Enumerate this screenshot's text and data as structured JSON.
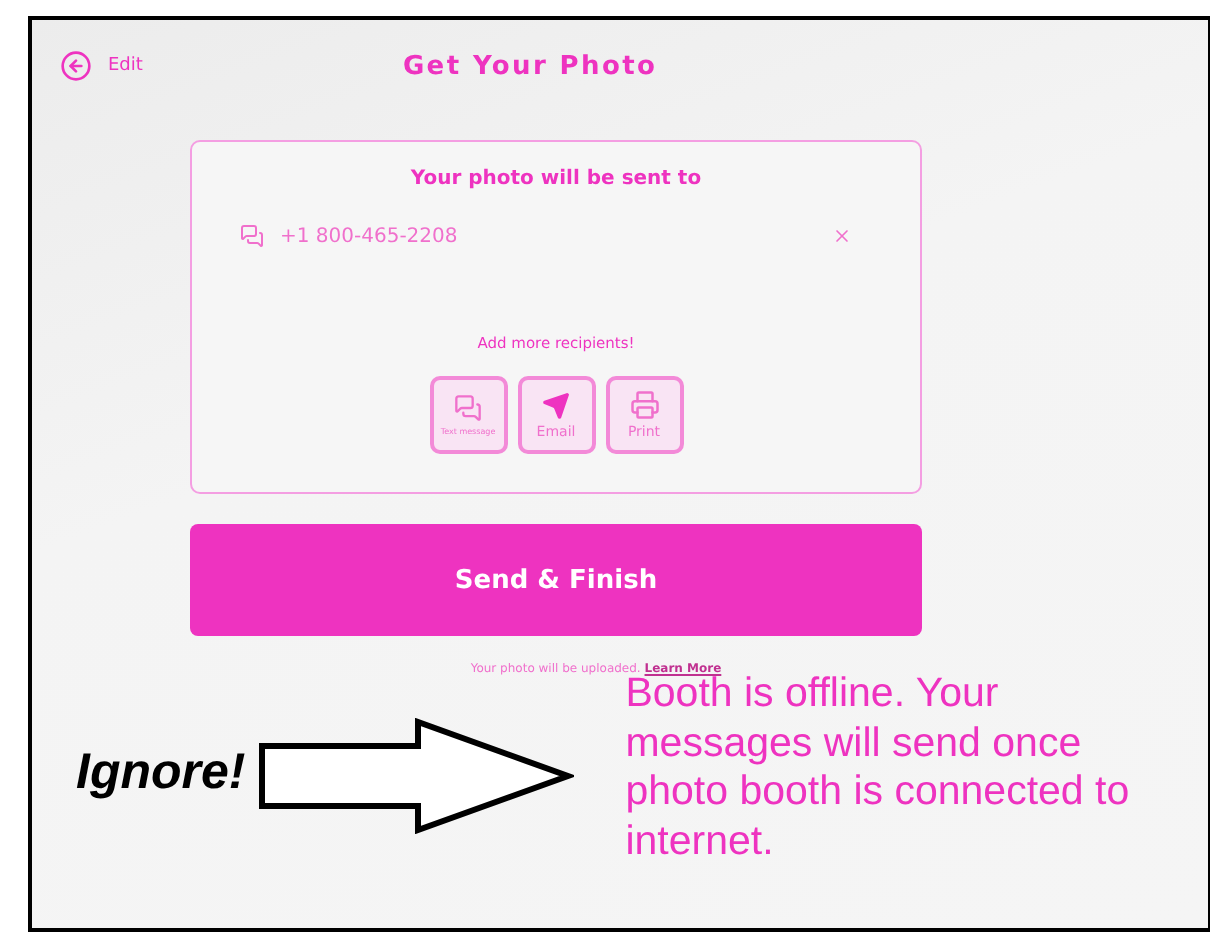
{
  "header": {
    "back_label": "Edit",
    "title": "Get Your Photo"
  },
  "card": {
    "heading": "Your photo will be sent to",
    "recipients": [
      {
        "value": "+1 800-465-2208"
      }
    ],
    "add_label": "Add more recipients!",
    "options": [
      {
        "kind": "text",
        "label": "Text message"
      },
      {
        "kind": "email",
        "label": "Email"
      },
      {
        "kind": "print",
        "label": "Print"
      }
    ]
  },
  "send_button": "Send & Finish",
  "upload_note": {
    "text": "Your photo will be uploaded.",
    "link": "Learn More"
  },
  "annotation": {
    "label": "Ignore!",
    "message": "Booth is offline. Your messages will send once photo booth is connected to internet."
  }
}
